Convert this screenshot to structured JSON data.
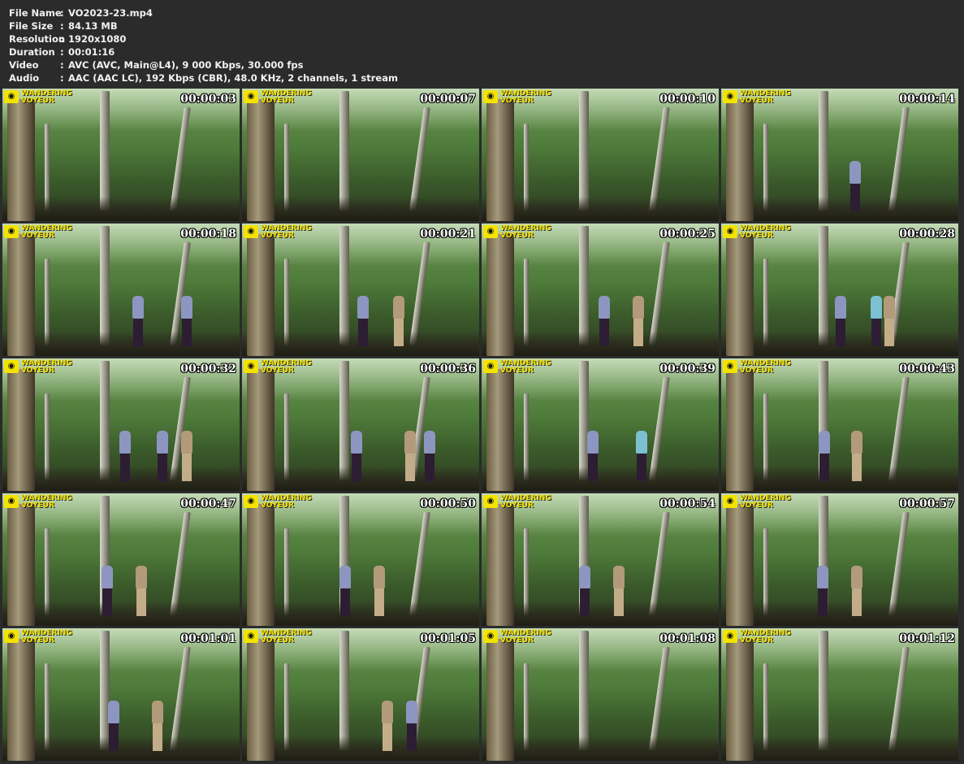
{
  "info": [
    {
      "label": "File Name",
      "value": "VO2023-23.mp4"
    },
    {
      "label": "File Size",
      "value": "84.13 MB"
    },
    {
      "label": "Resolution",
      "value": "1920x1080"
    },
    {
      "label": "Duration",
      "value": "00:01:16"
    },
    {
      "label": "Video",
      "value": "AVC (AVC, Main@L4), 9 000 Kbps, 30.000 fps"
    },
    {
      "label": "Audio",
      "value": "AAC (AAC LC), 192 Kbps (CBR), 48.0 KHz, 2 channels, 1 stream"
    }
  ],
  "logo": {
    "line1": "WANDERING",
    "line2": "VOYEUR",
    "icon": "camera-icon"
  },
  "thumbnails": [
    {
      "time": "00:00:03"
    },
    {
      "time": "00:00:07"
    },
    {
      "time": "00:00:10"
    },
    {
      "time": "00:00:14"
    },
    {
      "time": "00:00:18"
    },
    {
      "time": "00:00:21"
    },
    {
      "time": "00:00:25"
    },
    {
      "time": "00:00:28"
    },
    {
      "time": "00:00:32"
    },
    {
      "time": "00:00:36"
    },
    {
      "time": "00:00:39"
    },
    {
      "time": "00:00:43"
    },
    {
      "time": "00:00:47"
    },
    {
      "time": "00:00:50"
    },
    {
      "time": "00:00:54"
    },
    {
      "time": "00:00:57"
    },
    {
      "time": "00:01:01"
    },
    {
      "time": "00:01:05"
    },
    {
      "time": "00:01:08"
    },
    {
      "time": "00:01:12"
    }
  ]
}
